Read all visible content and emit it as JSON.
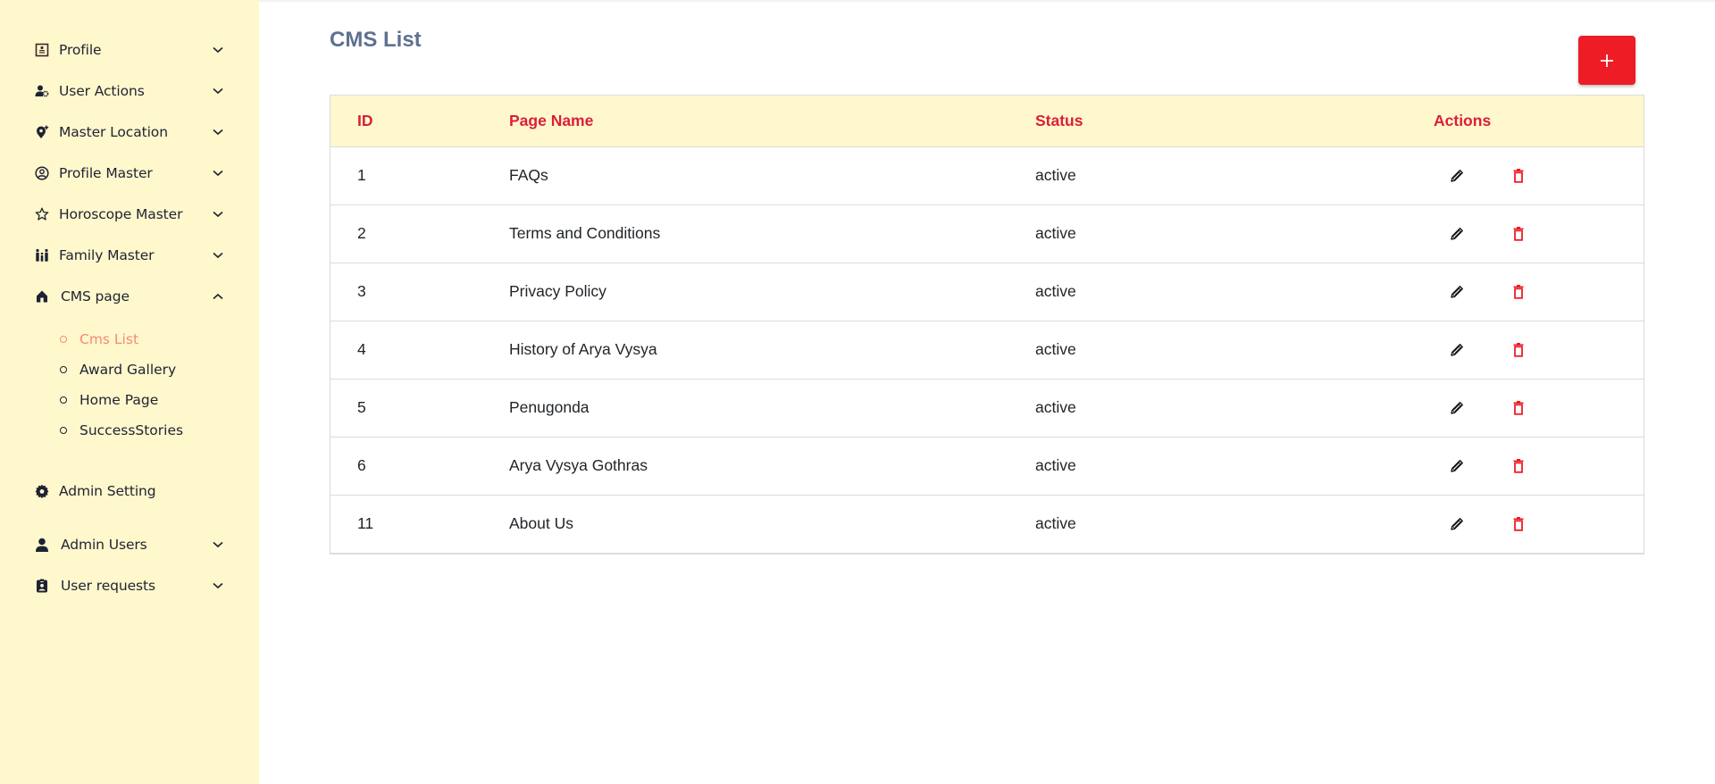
{
  "sidebar": {
    "items": [
      {
        "label": "Profile",
        "icon": "profile-card-icon",
        "expanded": false
      },
      {
        "label": "User Actions",
        "icon": "user-gear-icon",
        "expanded": false
      },
      {
        "label": "Master Location",
        "icon": "location-plus-icon",
        "expanded": false
      },
      {
        "label": "Profile Master",
        "icon": "user-circle-icon",
        "expanded": false
      },
      {
        "label": "Horoscope Master",
        "icon": "star-icon",
        "expanded": false
      },
      {
        "label": "Family Master",
        "icon": "family-icon",
        "expanded": false
      },
      {
        "label": "CMS page",
        "icon": "home-icon",
        "expanded": true
      },
      {
        "label": "Admin Setting",
        "icon": "gear-icon"
      },
      {
        "label": "Admin Users",
        "icon": "user-icon",
        "expanded": false
      },
      {
        "label": "User requests",
        "icon": "id-badge-icon",
        "expanded": false
      }
    ],
    "cms_sub_items": [
      {
        "label": "Cms List",
        "active": true
      },
      {
        "label": "Award Gallery",
        "active": false
      },
      {
        "label": "Home Page",
        "active": false
      },
      {
        "label": "SuccessStories",
        "active": false
      }
    ]
  },
  "main": {
    "title": "CMS List",
    "add_button": {
      "icon": "plus-icon",
      "label": "+"
    },
    "table": {
      "columns": [
        "ID",
        "Page Name",
        "Status",
        "Actions"
      ],
      "rows": [
        {
          "id": "1",
          "page_name": "FAQs",
          "status": "active"
        },
        {
          "id": "2",
          "page_name": "Terms and Conditions",
          "status": "active"
        },
        {
          "id": "3",
          "page_name": "Privacy Policy",
          "status": "active"
        },
        {
          "id": "4",
          "page_name": "History of Arya Vysya",
          "status": "active"
        },
        {
          "id": "5",
          "page_name": "Penugonda",
          "status": "active"
        },
        {
          "id": "6",
          "page_name": "Arya Vysya Gothras",
          "status": "active"
        },
        {
          "id": "11",
          "page_name": "About Us",
          "status": "active"
        }
      ],
      "row_actions": [
        "edit-icon",
        "delete-icon"
      ]
    }
  },
  "colors": {
    "sidebar_bg": "#fef8cc",
    "accent_red": "#ee1c25",
    "header_text": "#dc1e3a",
    "active_sub_item": "#f28b78",
    "title": "#5f7190"
  }
}
